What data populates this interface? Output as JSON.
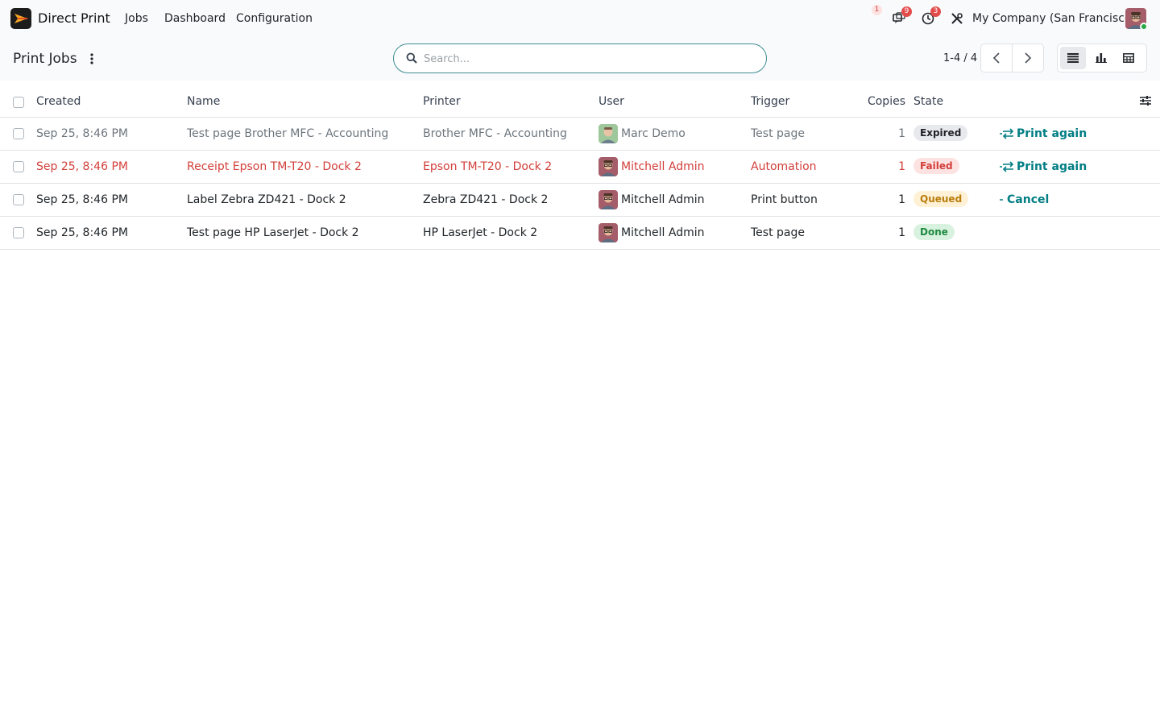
{
  "navbar": {
    "app_name": "Direct Print",
    "menu": [
      "Jobs",
      "Dashboard",
      "Configuration"
    ],
    "systray": {
      "notification_badge": "1",
      "messages_badge": "9",
      "activities_badge": "3"
    },
    "company": "My Company (San Francisco)"
  },
  "control": {
    "title": "Print Jobs",
    "search_placeholder": "Search...",
    "pager": "1-4 / 4"
  },
  "table": {
    "headers": {
      "created": "Created",
      "name": "Name",
      "printer": "Printer",
      "user": "User",
      "trigger": "Trigger",
      "copies": "Copies",
      "state": "State"
    },
    "rows": [
      {
        "created": "Sep 25, 8:46 PM",
        "name": "Test page Brother MFC - Accounting",
        "printer": "Brother MFC - Accounting",
        "user": "Marc Demo",
        "trigger": "Test page",
        "copies": "1",
        "state": "Expired",
        "action": "Print again"
      },
      {
        "created": "Sep 25, 8:46 PM",
        "name": "Receipt Epson TM-T20 - Dock 2",
        "printer": "Epson TM-T20 - Dock 2",
        "user": "Mitchell Admin",
        "trigger": "Automation",
        "copies": "1",
        "state": "Failed",
        "action": "Print again"
      },
      {
        "created": "Sep 25, 8:46 PM",
        "name": "Label Zebra ZD421 - Dock 2",
        "printer": "Zebra ZD421 - Dock 2",
        "user": "Mitchell Admin",
        "trigger": "Print button",
        "copies": "1",
        "state": "Queued",
        "action": "Cancel"
      },
      {
        "created": "Sep 25, 8:46 PM",
        "name": "Test page HP LaserJet - Dock 2",
        "printer": "HP LaserJet - Dock 2",
        "user": "Mitchell Admin",
        "trigger": "Test page",
        "copies": "1",
        "state": "Done",
        "action": ""
      }
    ]
  },
  "colors": {
    "accent": "#017e84",
    "danger": "#d23f3a",
    "expired_bg": "#e7e9ed",
    "failed_bg": "#fde2e2",
    "queued_bg": "#fff1d6",
    "done_bg": "#d9f2e0"
  }
}
